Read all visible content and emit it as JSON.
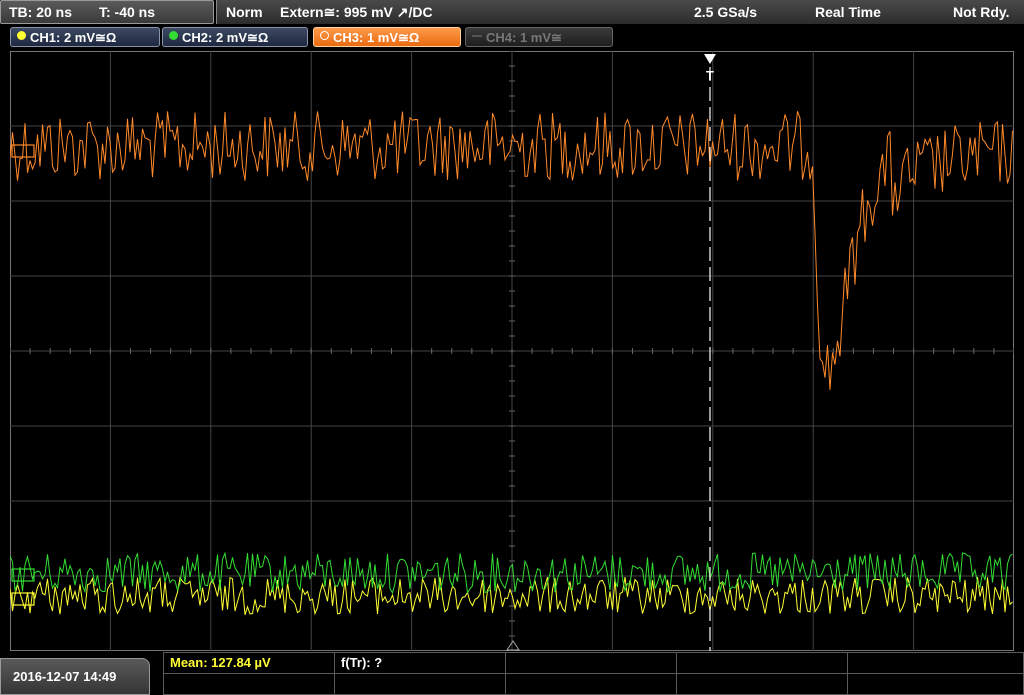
{
  "timebase": {
    "tb": "TB: 20 ns",
    "t": "T: -40 ns"
  },
  "status_bar": {
    "mode": "Norm",
    "trigger": "Extern≅: 995 mV ↗/DC",
    "sample_rate": "2.5 GSa/s",
    "acquisition": "Real Time",
    "state": "Not Rdy."
  },
  "channels": [
    {
      "label": "CH1: 2 mV≅Ω",
      "color": "#ffff33",
      "active": false,
      "enabled": true
    },
    {
      "label": "CH2: 2 mV≅Ω",
      "color": "#33dd33",
      "active": false,
      "enabled": true
    },
    {
      "label": "CH3: 1 mV≅Ω",
      "color": "#ff8a2a",
      "active": true,
      "enabled": true
    },
    {
      "label": "CH4: 1 mV≅",
      "color": "#777777",
      "active": false,
      "enabled": false
    }
  ],
  "trigger_marker": {
    "label": "T"
  },
  "measurement": {
    "mean": "Mean: 127.84 µV",
    "freq": "f(Tr): ?"
  },
  "date": "2016-12-07  14:49",
  "colors": {
    "ch1": "#ffff33",
    "ch2": "#33dd33",
    "ch3": "#ff8a2a",
    "grid": "#444444"
  }
}
